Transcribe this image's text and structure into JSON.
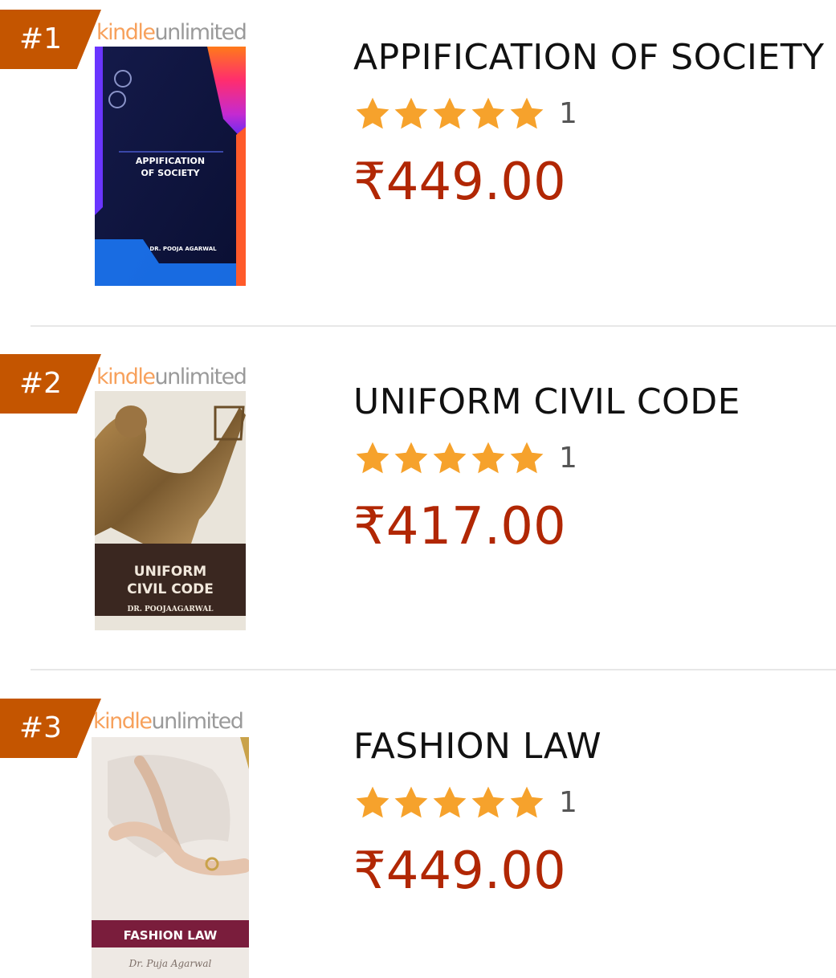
{
  "list": {
    "items": [
      {
        "rank": "#1",
        "badge_left": "kindle",
        "badge_right": "unlimited",
        "title": "APPIFICATION OF SOCIETY",
        "rating_count": "1",
        "price": "₹449.00",
        "cover_title_line1": "APPIFICATION",
        "cover_title_line2": "OF SOCIETY",
        "cover_author": "DR. POOJA AGARWAL"
      },
      {
        "rank": "#2",
        "badge_left": "kindle",
        "badge_right": "unlimited",
        "title": "UNIFORM CIVIL CODE",
        "rating_count": "1",
        "price": "₹417.00",
        "cover_title_line1": "UNIFORM",
        "cover_title_line2": "CIVIL CODE",
        "cover_author": "DR. POOJAAGARWAL"
      },
      {
        "rank": "#3",
        "badge_left": "kindle",
        "badge_right": "unlimited",
        "title": "FASHION LAW",
        "rating_count": "1",
        "price": "₹449.00",
        "cover_title_line1": "FASHION LAW",
        "cover_author": "Dr. Puja Agarwal"
      }
    ]
  },
  "rating": {
    "stars": 5,
    "max": 5
  },
  "colors": {
    "rank_badge": "#c45500",
    "price": "#b12704",
    "star": "#f6a22c",
    "kindle": "#f7a15c"
  }
}
